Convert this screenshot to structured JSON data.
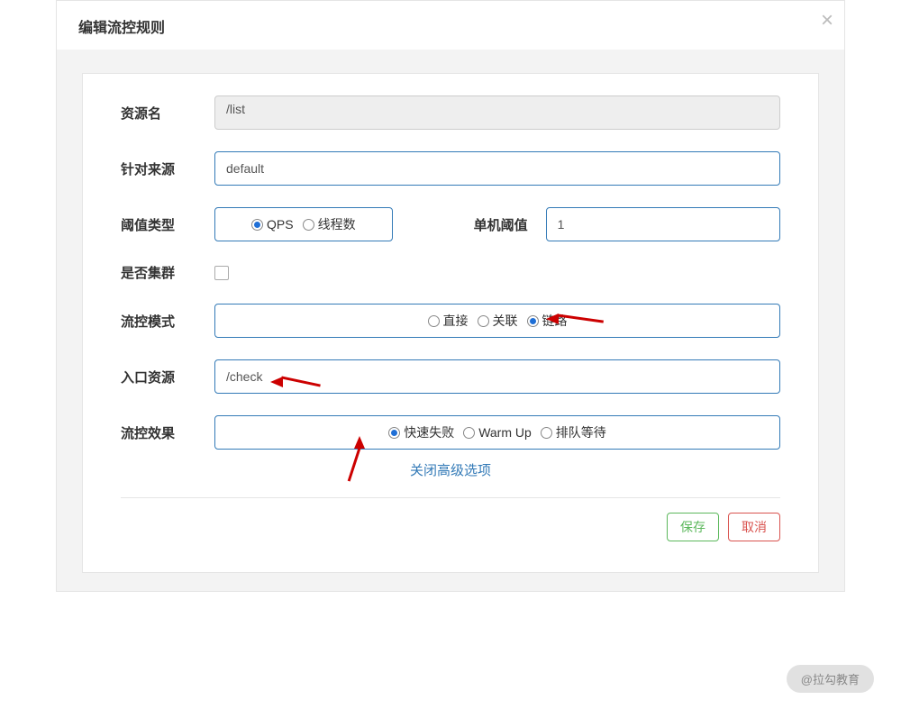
{
  "modal": {
    "title": "编辑流控规则"
  },
  "form": {
    "resourceName": {
      "label": "资源名",
      "value": "/list"
    },
    "origin": {
      "label": "针对来源",
      "value": "default"
    },
    "thresholdType": {
      "label": "阈值类型",
      "options": {
        "qps": "QPS",
        "threads": "线程数"
      },
      "selected": "qps"
    },
    "singleThreshold": {
      "label": "单机阈值",
      "value": "1"
    },
    "cluster": {
      "label": "是否集群",
      "checked": false
    },
    "flowMode": {
      "label": "流控模式",
      "options": {
        "direct": "直接",
        "relate": "关联",
        "chain": "链路"
      },
      "selected": "chain"
    },
    "entryResource": {
      "label": "入口资源",
      "value": "/check"
    },
    "flowEffect": {
      "label": "流控效果",
      "options": {
        "fail": "快速失败",
        "warmup": "Warm Up",
        "queue": "排队等待"
      },
      "selected": "fail"
    },
    "advLink": "关闭高级选项"
  },
  "footer": {
    "save": "保存",
    "cancel": "取消"
  },
  "watermark": "@拉勾教育"
}
